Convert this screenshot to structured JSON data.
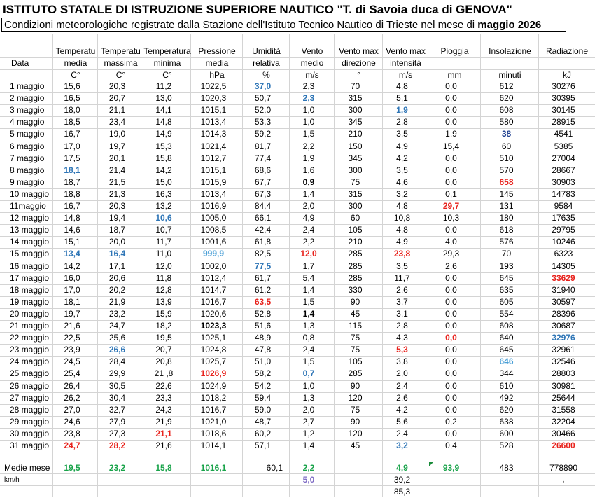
{
  "title": "ISTITUTO STATALE DI ISTRUZIONE SUPERIORE NAUTICO \"T. di Savoia duca di GENOVA\"",
  "subtitle_prefix": "Condizioni meteorologiche registrate dalla Stazione dell'Istituto Tecnico Nautico di Trieste nel mese di ",
  "subtitle_month": "maggio 2026",
  "headers": [
    [
      "",
      "Data",
      ""
    ],
    [
      "Temperatu",
      "media",
      "C°"
    ],
    [
      "Temperatu",
      "massima",
      "C°"
    ],
    [
      "Temperatura",
      "minima",
      "C°"
    ],
    [
      "Pressione",
      "media",
      "hPa"
    ],
    [
      "Umidità",
      "relativa",
      "%"
    ],
    [
      "Vento",
      "medio",
      "m/s"
    ],
    [
      "Vento max",
      "direzione",
      "°"
    ],
    [
      "Vento max",
      "intensità",
      "m/s"
    ],
    [
      "Pioggia",
      "",
      "mm"
    ],
    [
      "Insolazione",
      "",
      "minuti"
    ],
    [
      "Radiazione",
      "",
      "kJ"
    ]
  ],
  "rows": [
    [
      "1 maggio",
      "15,6",
      "20,3",
      "11,2",
      "1022,5",
      "37,0",
      "2,3",
      "70",
      "4,8",
      "0,0",
      "612",
      "30276"
    ],
    [
      "2 maggio",
      "16,5",
      "20,7",
      "13,0",
      "1020,3",
      "50,7",
      "2,3",
      "315",
      "5,1",
      "0,0",
      "620",
      "30395"
    ],
    [
      "3 maggio",
      "18,0",
      "21,1",
      "14,1",
      "1015,1",
      "52,0",
      "1,0",
      "300",
      "1,9",
      "0,0",
      "608",
      "30145"
    ],
    [
      "4 maggio",
      "18,5",
      "23,4",
      "14,8",
      "1013,4",
      "53,3",
      "1,0",
      "345",
      "2,8",
      "0,0",
      "580",
      "28915"
    ],
    [
      "5 maggio",
      "16,7",
      "19,0",
      "14,9",
      "1014,3",
      "59,2",
      "1,5",
      "210",
      "3,5",
      "1,9",
      "38",
      "4541"
    ],
    [
      "6 maggio",
      "17,0",
      "19,7",
      "15,3",
      "1021,4",
      "81,7",
      "2,2",
      "150",
      "4,9",
      "15,4",
      "60",
      "5385"
    ],
    [
      "7 maggio",
      "17,5",
      "20,1",
      "15,8",
      "1012,7",
      "77,4",
      "1,9",
      "345",
      "4,2",
      "0,0",
      "510",
      "27004"
    ],
    [
      "8 maggio",
      "18,1",
      "21,4",
      "14,2",
      "1015,1",
      "68,6",
      "1,6",
      "300",
      "3,5",
      "0,0",
      "570",
      "28667"
    ],
    [
      "9 maggio",
      "18,7",
      "21,5",
      "15,0",
      "1015,9",
      "67,7",
      "0,9",
      "75",
      "4,6",
      "0,0",
      "658",
      "30903"
    ],
    [
      "10 maggio",
      "18,8",
      "21,3",
      "16,3",
      "1013,4",
      "67,3",
      "1,4",
      "315",
      "3,2",
      "0,1",
      "145",
      "14783"
    ],
    [
      "11maggio",
      "16,7",
      "20,3",
      "13,2",
      "1016,9",
      "84,4",
      "2,0",
      "300",
      "4,8",
      "29,7",
      "131",
      "9584"
    ],
    [
      "12 maggio",
      "14,8",
      "19,4",
      "10,6",
      "1005,0",
      "66,1",
      "4,9",
      "60",
      "10,8",
      "10,3",
      "180",
      "17635"
    ],
    [
      "13 maggio",
      "14,6",
      "18,7",
      "10,7",
      "1008,5",
      "42,4",
      "2,4",
      "105",
      "4,8",
      "0,0",
      "618",
      "29795"
    ],
    [
      "14 maggio",
      "15,1",
      "20,0",
      "11,7",
      "1001,6",
      "61,8",
      "2,2",
      "210",
      "4,9",
      "4,0",
      "576",
      "10246"
    ],
    [
      "15 maggio",
      "13,4",
      "16,4",
      "11,0",
      "999,9",
      "82,5",
      "12,0",
      "285",
      "23,8",
      "29,3",
      "70",
      "6323"
    ],
    [
      "16 maggio",
      "14,2",
      "17,1",
      "12,0",
      "1002,0",
      "77,5",
      "1,7",
      "285",
      "3,5",
      "2,6",
      "193",
      "14305"
    ],
    [
      "17 maggio",
      "16,0",
      "20,6",
      "11,8",
      "1012,4",
      "61,7",
      "5,4",
      "285",
      "11,7",
      "0,0",
      "645",
      "33629"
    ],
    [
      "18 maggio",
      "17,0",
      "20,2",
      "12,8",
      "1014,7",
      "61,2",
      "1,4",
      "330",
      "2,6",
      "0,0",
      "635",
      "31940"
    ],
    [
      "19 maggio",
      "18,1",
      "21,9",
      "13,9",
      "1016,7",
      "63,5",
      "1,5",
      "90",
      "3,7",
      "0,0",
      "605",
      "30597"
    ],
    [
      "20 maggio",
      "19,7",
      "23,2",
      "15,9",
      "1020,6",
      "52,8",
      "1,4",
      "45",
      "3,1",
      "0,0",
      "554",
      "28396"
    ],
    [
      "21 maggio",
      "21,6",
      "24,7",
      "18,2",
      "1023,3",
      "51,6",
      "1,3",
      "115",
      "2,8",
      "0,0",
      "608",
      "30687"
    ],
    [
      "22 maggio",
      "22,5",
      "25,6",
      "19,5",
      "1025,1",
      "48,9",
      "0,8",
      "75",
      "4,3",
      "0,0",
      "640",
      "32976"
    ],
    [
      "23 maggio",
      "23,9",
      "26,6",
      "20,7",
      "1024,8",
      "47,8",
      "2,4",
      "75",
      "5,3",
      "0,0",
      "645",
      "32961"
    ],
    [
      "24 maggio",
      "24,5",
      "28,4",
      "20,8",
      "1025,7",
      "51,0",
      "1,5",
      "105",
      "3,8",
      "0,0",
      "646",
      "32546"
    ],
    [
      "25 maggio",
      "25,4",
      "29,9",
      "21 ,8",
      "1026,9",
      "58,2",
      "0,7",
      "285",
      "2,0",
      "0,0",
      "344",
      "28803"
    ],
    [
      "26 maggio",
      "26,4",
      "30,5",
      "22,6",
      "1024,9",
      "54,2",
      "1,0",
      "90",
      "2,4",
      "0,0",
      "610",
      "30981"
    ],
    [
      "27 maggio",
      "26,2",
      "30,4",
      "23,3",
      "1018,2",
      "59,4",
      "1,3",
      "120",
      "2,6",
      "0,0",
      "492",
      "25644"
    ],
    [
      "28 maggio",
      "27,0",
      "32,7",
      "24,3",
      "1016,7",
      "59,0",
      "2,0",
      "75",
      "4,2",
      "0,0",
      "620",
      "31558"
    ],
    [
      "29 maggio",
      "24,6",
      "27,9",
      "21,9",
      "1021,0",
      "48,7",
      "2,7",
      "90",
      "5,6",
      "0,2",
      "638",
      "32204"
    ],
    [
      "30 maggio",
      "23,8",
      "27,3",
      "21,1",
      "1018,6",
      "60,2",
      "1,2",
      "120",
      "2,4",
      "0,0",
      "600",
      "30466"
    ],
    [
      "31 maggio",
      "24,7",
      "28,2",
      "21,6",
      "1014,1",
      "57,1",
      "1,4",
      "45",
      "3,2",
      "0,4",
      "528",
      "26600"
    ]
  ],
  "highlights": {
    "0-5": "blue",
    "1-6": "blue",
    "2-8": "blue",
    "4-10": "darkblue",
    "8-6": "bold",
    "8-10": "red",
    "7-1": "blue",
    "10-9": "red",
    "11-3": "blue",
    "14-1": "blue",
    "14-2": "blue",
    "14-4": "lblue",
    "14-6": "red",
    "14-8": "red",
    "15-5": "blue",
    "16-11": "red",
    "18-5": "red",
    "19-6": "bold",
    "20-4": "bold",
    "21-9": "red",
    "21-11": "blue",
    "22-2": "blue",
    "22-8": "red",
    "23-10": "lblue",
    "24-4": "red",
    "24-6": "blue",
    "29-3": "red",
    "30-1": "red",
    "30-2": "red",
    "30-8": "blue",
    "30-11": "red"
  },
  "summary": {
    "label": "Medie mese",
    "values": [
      "19,5",
      "23,2",
      "15,8",
      "1016,1",
      "60,1",
      "2,2",
      "",
      "4,9",
      "93,9",
      "483",
      "778890"
    ],
    "kmh_label": "km/h",
    "kmh_wind": "5,0",
    "kmh_max1": "39,2",
    "kmh_max2": "85,3",
    "comma_mark": ","
  }
}
